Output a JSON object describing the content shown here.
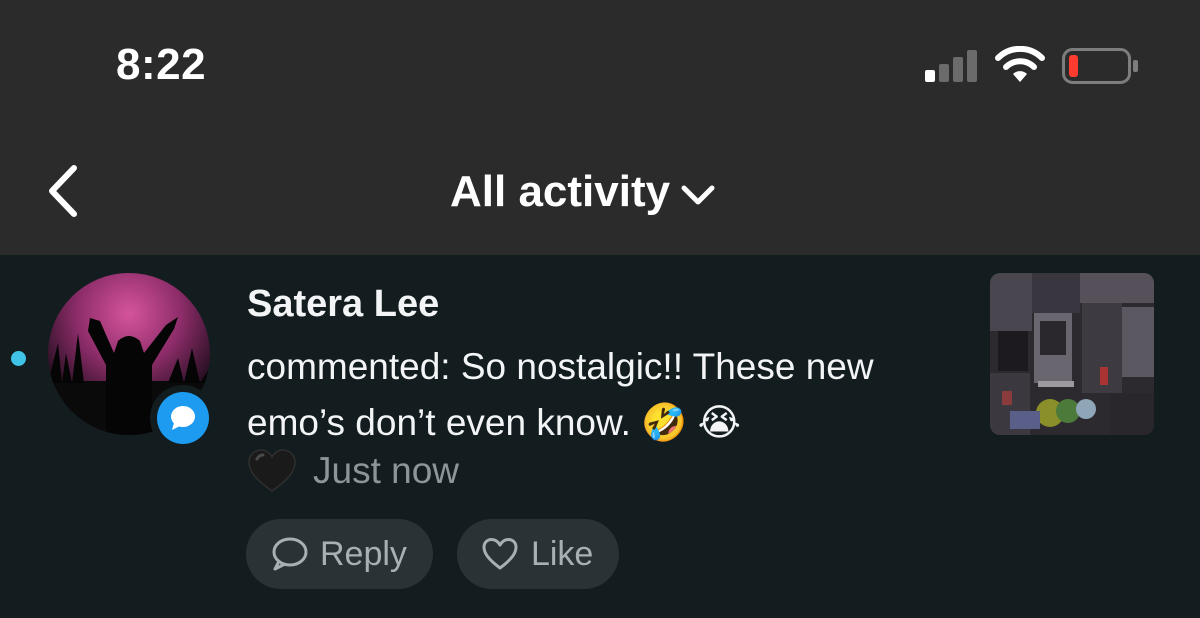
{
  "status_bar": {
    "time": "8:22",
    "icons": [
      "signal-icon",
      "wifi-icon",
      "battery-low-icon"
    ],
    "battery_color": "#ff3b30"
  },
  "nav": {
    "back_icon": "chevron-left-icon",
    "title": "All activity",
    "title_icon": "chevron-down-icon"
  },
  "activity": {
    "unread": true,
    "unread_color": "#3fc4e8",
    "user_name": "Satera Lee",
    "badge_icon": "comment-bubble-icon",
    "badge_color": "#1d9bf0",
    "comment_text": "commented: So nostalgic!! These new emo’s don’t even know. 🤣 😭",
    "heart_icon": "black-heart-emoji",
    "timestamp": "Just now",
    "actions": {
      "reply_label": "Reply",
      "reply_icon": "comment-outline-icon",
      "like_label": "Like",
      "like_icon": "heart-outline-icon"
    },
    "thumbnail": "post-thumbnail-image"
  },
  "colors": {
    "header_bg": "#2b2b2b",
    "content_bg": "#131c1f",
    "pill_bg": "#2a3235",
    "muted_text": "#8c9599"
  }
}
